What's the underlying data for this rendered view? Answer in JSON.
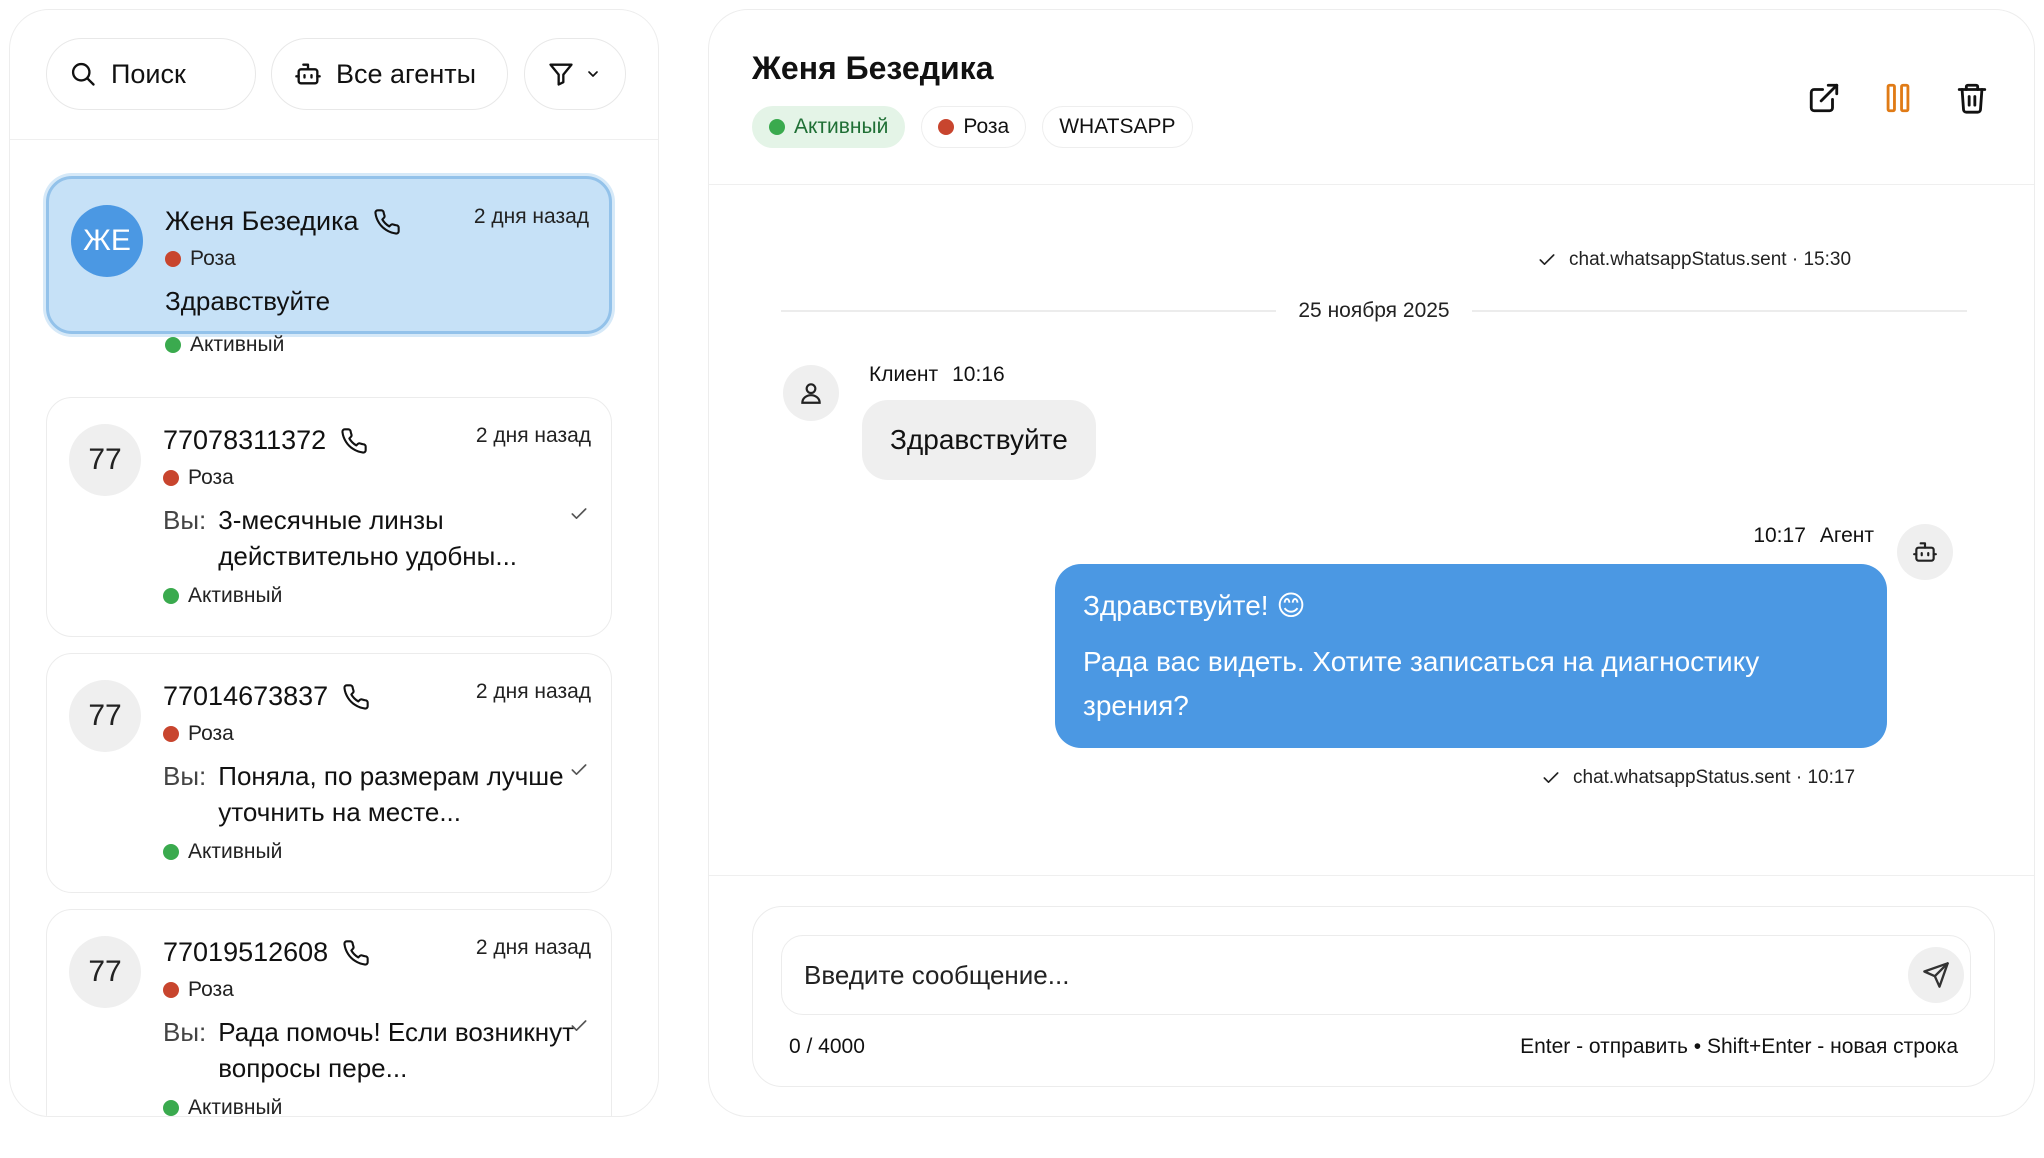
{
  "toolbar": {
    "search_label": "Поиск",
    "agents_label": "Все агенты"
  },
  "chats": [
    {
      "avatar": "ЖЕ",
      "name": "Женя Безедика",
      "time": "2 дня назад",
      "agent": "Роза",
      "you_prefix": "",
      "message": "Здравствуйте",
      "status": "Активный",
      "active": true
    },
    {
      "avatar": "77",
      "name": "77078311372",
      "time": "2 дня назад",
      "agent": "Роза",
      "you_prefix": "Вы:",
      "message": "3-месячные линзы действительно удобны...",
      "status": "Активный"
    },
    {
      "avatar": "77",
      "name": "77014673837",
      "time": "2 дня назад",
      "agent": "Роза",
      "you_prefix": "Вы:",
      "message": "Поняла, по размерам лучше уточнить на месте...",
      "status": "Активный"
    },
    {
      "avatar": "77",
      "name": "77019512608",
      "time": "2 дня назад",
      "agent": "Роза",
      "you_prefix": "Вы:",
      "message": "Рада помочь! Если возникнут вопросы пере...",
      "status": "Активный"
    }
  ],
  "header": {
    "name": "Женя Безедика",
    "status_tag": "Активный",
    "agent_tag": "Роза",
    "channel_tag": "WHATSAPP"
  },
  "messages": {
    "top_status": "chat.whatsappStatus.sent · 15:30",
    "date": "25 ноября 2025",
    "incoming": {
      "sender": "Клиент",
      "time": "10:16",
      "text": "Здравствуйте"
    },
    "outgoing": {
      "sender": "Агент",
      "time": "10:17",
      "line1": "Здравствуйте! 😊",
      "line2": "Рада вас видеть. Хотите записаться на диагностику зрения?",
      "status": "chat.whatsappStatus.sent · 10:17"
    }
  },
  "composer": {
    "placeholder": "Введите сообщение...",
    "char_count": "0 / 4000",
    "hint": "Enter - отправить • Shift+Enter - новая строка"
  },
  "colors": {
    "accent": "#4b98e3",
    "active_card": "#c6e1f7",
    "status_green": "#3aaa4e",
    "agent_red": "#c8452e",
    "pause_orange": "#e07b16"
  }
}
